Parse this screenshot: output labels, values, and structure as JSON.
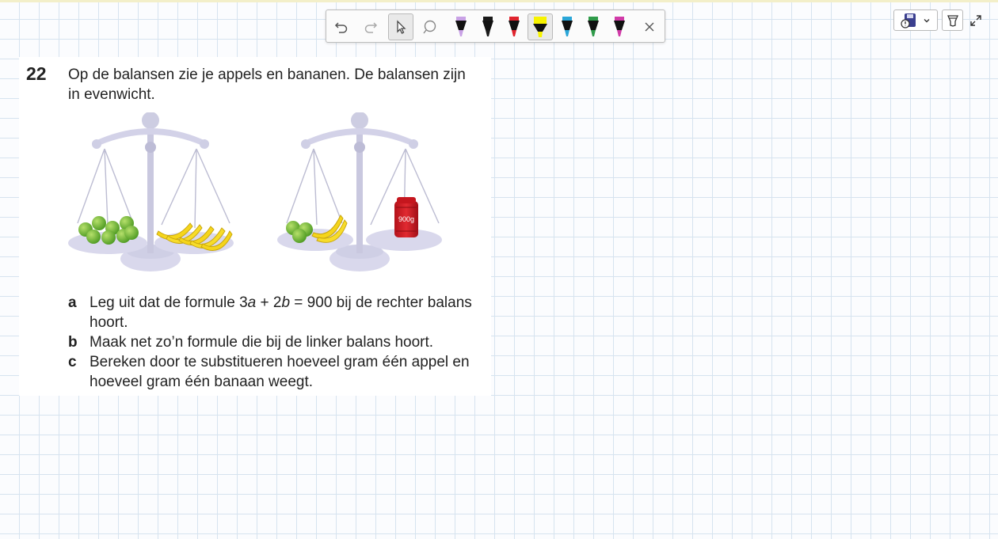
{
  "toolbar": {
    "tools": [
      "undo-icon",
      "redo-icon",
      "pointer-icon",
      "lasso-icon"
    ],
    "selected_tool": "highlighter-yellow",
    "markers": [
      {
        "name": "marker-lilac",
        "color": "#c9a2e6"
      },
      {
        "name": "marker-black",
        "color": "#1a1a1a"
      },
      {
        "name": "marker-red",
        "color": "#e0242e"
      },
      {
        "name": "highlighter-yellow",
        "color": "#f7f300"
      },
      {
        "name": "marker-blue",
        "color": "#2aa6d8"
      },
      {
        "name": "marker-green",
        "color": "#2f9b4a"
      },
      {
        "name": "marker-magenta",
        "color": "#d13aa8"
      }
    ]
  },
  "exercise": {
    "number": "22",
    "intro": "Op de balansen zie je appels en bananen. De balansen zijn in evenwicht.",
    "weight_label": "900g",
    "questions": [
      {
        "letter": "a",
        "text_before": "Leg uit dat de formule 3",
        "var1": "a",
        "mid": " + 2",
        "var2": "b",
        "text_after": " = 900 bij de rechter balans hoort."
      },
      {
        "letter": "b",
        "text": "Maak net zo’n formule die bij de linker balans hoort."
      },
      {
        "letter": "c",
        "text": "Bereken door te substitueren hoeveel gram één appel en hoeveel gram één banaan weegt."
      }
    ]
  }
}
